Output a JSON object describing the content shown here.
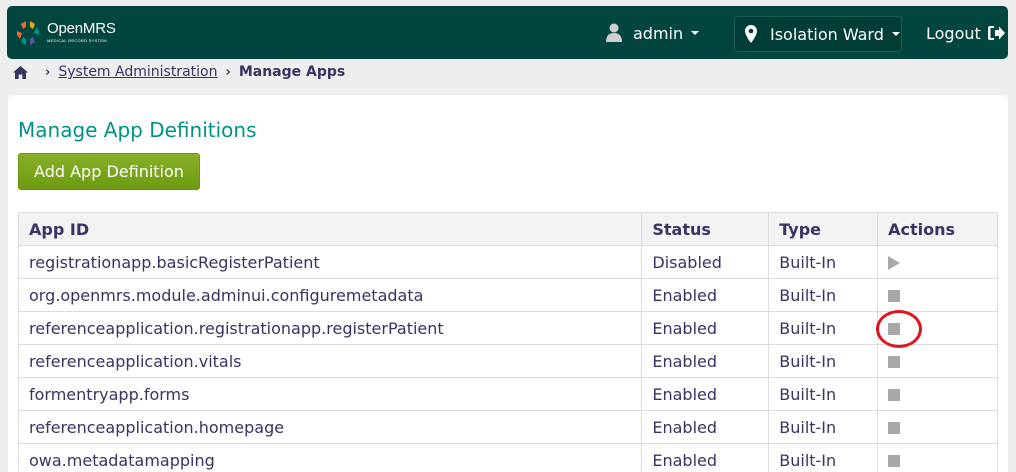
{
  "header": {
    "logo_name": "OpenMRS",
    "logo_tagline": "MEDICAL RECORD SYSTEM",
    "user_label": "admin",
    "location_label": "Isolation Ward",
    "logout_label": "Logout",
    "background_color": "#00463f"
  },
  "breadcrumb": {
    "home_icon": "home-icon",
    "items": [
      "System Administration",
      "Manage Apps"
    ]
  },
  "page": {
    "title": "Manage App Definitions",
    "add_button_label": "Add App Definition"
  },
  "table": {
    "columns": [
      "App ID",
      "Status",
      "Type",
      "Actions"
    ],
    "rows": [
      {
        "app_id": "registrationapp.basicRegisterPatient",
        "status": "Disabled",
        "type": "Built-In",
        "action": "play-icon"
      },
      {
        "app_id": "org.openmrs.module.adminui.configuremetadata",
        "status": "Enabled",
        "type": "Built-In",
        "action": "stop-icon"
      },
      {
        "app_id": "referenceapplication.registrationapp.registerPatient",
        "status": "Enabled",
        "type": "Built-In",
        "action": "stop-icon"
      },
      {
        "app_id": "referenceapplication.vitals",
        "status": "Enabled",
        "type": "Built-In",
        "action": "stop-icon"
      },
      {
        "app_id": "formentryapp.forms",
        "status": "Enabled",
        "type": "Built-In",
        "action": "stop-icon"
      },
      {
        "app_id": "referenceapplication.homepage",
        "status": "Enabled",
        "type": "Built-In",
        "action": "stop-icon"
      },
      {
        "app_id": "owa.metadatamapping",
        "status": "Enabled",
        "type": "Built-In",
        "action": "stop-icon"
      }
    ]
  },
  "colors": {
    "accent": "#009384",
    "button_green": "#7aa51c",
    "highlight_red": "#e0141c"
  }
}
